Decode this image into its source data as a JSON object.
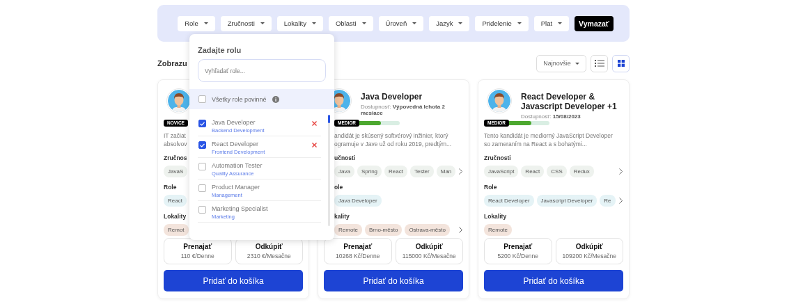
{
  "filters": [
    {
      "label": "Role",
      "kind": "dropdown"
    },
    {
      "label": "Zručnosti",
      "kind": "dropdown"
    },
    {
      "label": "Lokality",
      "kind": "dropdown"
    },
    {
      "label": "Oblasti",
      "kind": "dropdown"
    },
    {
      "label": "Úroveň",
      "kind": "dropdown"
    },
    {
      "label": "Jazyk",
      "kind": "dropdown"
    },
    {
      "label": "Pridelenie",
      "kind": "dropdown"
    },
    {
      "label": "Plat",
      "kind": "dropdown"
    },
    {
      "label": "Vymazať",
      "kind": "clear"
    }
  ],
  "results": {
    "heading": "Zobrazu",
    "sort": "Najnovšie",
    "views": [
      {
        "kind": "list",
        "selected": false
      },
      {
        "kind": "grid",
        "selected": true
      }
    ]
  },
  "role_dropdown": {
    "title": "Zadajte rolu",
    "search": {
      "placeholder": "Vyhľadať role..."
    },
    "all_required": {
      "label": "Všetky role povinné",
      "checked": false
    },
    "options": [
      {
        "name": "Java Developer",
        "category": "Backend Development",
        "checked": true
      },
      {
        "name": "React Developer",
        "category": "Frontend Development",
        "checked": true
      },
      {
        "name": "Automation Tester",
        "category": "Quality Assurance",
        "checked": false
      },
      {
        "name": "Product Manager",
        "category": "Management",
        "checked": false
      },
      {
        "name": "Marketing Specialist",
        "category": "Marketing",
        "checked": false
      }
    ]
  },
  "cards": [
    {
      "level_label": "NOVICE",
      "description": [
        "IT začiat",
        "absolvov"
      ],
      "skills_heading": "Zručnos",
      "skills": [
        "JavaS"
      ],
      "roles_heading": "Role",
      "roles": [
        "React"
      ],
      "locations_heading": "Lokality",
      "locations": [
        "Remot"
      ],
      "offers": [
        {
          "label": "Prenajať",
          "price": "110 €/Denne"
        },
        {
          "label": "Odkúpiť",
          "price": "2310 €/Mesačne"
        }
      ],
      "cart_button": "Pridať do košíka"
    },
    {
      "title": "Java Developer",
      "availability_label": "Dostupnosť:",
      "availability_value": "Výpovedná lehota 2 mesiace",
      "level_label": "MEDIOR",
      "level": 0.56,
      "description": [
        "andidát je skúsený softvérový inžinier, ktorý",
        "ogramuje v Jave už od roku 2019, predtým..."
      ],
      "skills_heading": "učnosti",
      "skills": [
        "Java",
        "Spring",
        "React",
        "Tester",
        "Man"
      ],
      "skills_more": true,
      "roles_heading": "ole",
      "roles": [
        "Java Developer"
      ],
      "locations_heading": "kality",
      "locations": [
        "Remote",
        "Brno-město",
        "Ostrava-město"
      ],
      "locations_more": true,
      "offers": [
        {
          "label": "Prenajať",
          "price": "10268 Kč/Denne"
        },
        {
          "label": "Odkúpiť",
          "price": "115000 Kč/Mesačne"
        }
      ],
      "cart_button": "Pridať do košíka"
    },
    {
      "title": "React Developer & Javascript Developer +1",
      "availability_label": "Dostupnosť:",
      "availability_value": "15/08/2023",
      "level_label": "MEDIOR",
      "level": 0.58,
      "description": [
        "Tento kandidát je mediorný JavaScript Developer",
        "so zameraním na React a s bohatými..."
      ],
      "skills_heading": "Zručnosti",
      "skills": [
        "JavaScript",
        "React",
        "CSS",
        "Redux"
      ],
      "skills_more": true,
      "roles_heading": "Role",
      "roles": [
        "React Developer",
        "Javascript Developer",
        "Re"
      ],
      "roles_more": true,
      "locations_heading": "Lokality",
      "locations": [
        "Remote"
      ],
      "offers": [
        {
          "label": "Prenajať",
          "price": "5200 Kč/Denne"
        },
        {
          "label": "Odkúpiť",
          "price": "109200 Kč/Mesačne"
        }
      ],
      "cart_button": "Pridať do košíka"
    }
  ]
}
